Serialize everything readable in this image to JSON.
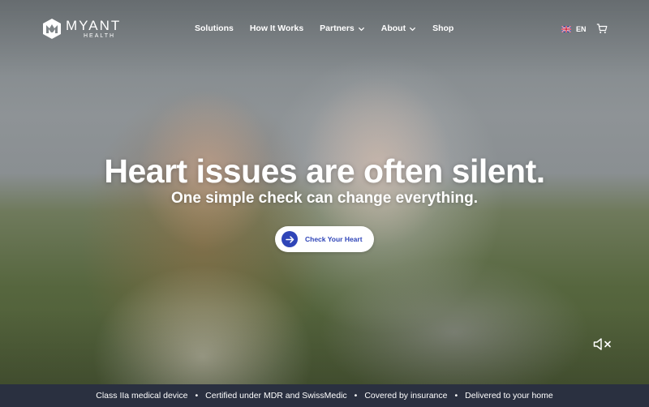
{
  "brand": {
    "name": "MYANT",
    "sub": "HEALTH"
  },
  "nav": {
    "items": [
      {
        "label": "Solutions",
        "dropdown": false
      },
      {
        "label": "How It Works",
        "dropdown": false
      },
      {
        "label": "Partners",
        "dropdown": true
      },
      {
        "label": "About",
        "dropdown": true
      },
      {
        "label": "Shop",
        "dropdown": false
      }
    ],
    "language": "EN"
  },
  "hero": {
    "headline": "Heart issues are often silent.",
    "subheadline": "One simple check can change everything.",
    "cta_label": "Check Your Heart"
  },
  "footer_bar": {
    "items": [
      "Class IIa medical device",
      "Certified under MDR and SwissMedic",
      "Covered by insurance",
      "Delivered to your home"
    ],
    "separator": "•"
  },
  "icons": {
    "logo": "myant-hexagon-logo-icon",
    "nav_chevron": "chevron-down-icon",
    "language_flag": "uk-flag-icon",
    "cart": "cart-icon",
    "cta": "arrow-right-icon",
    "mute": "volume-muted-icon"
  },
  "colors": {
    "accent": "#2f45b8",
    "footer_bar_bg": "#2a3040",
    "text": "#ffffff"
  }
}
